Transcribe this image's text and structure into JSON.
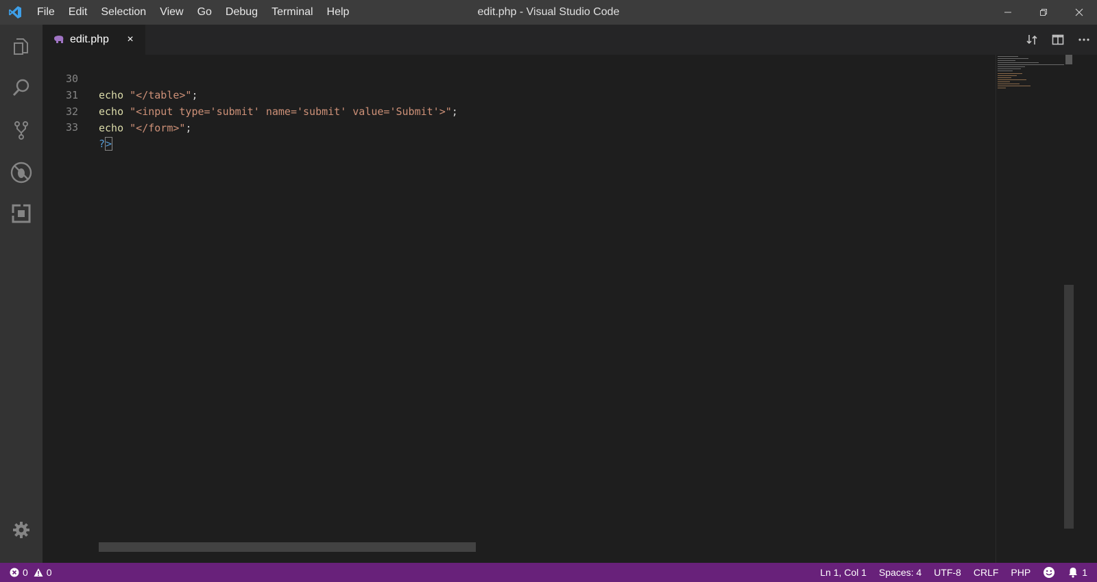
{
  "window": {
    "title": "edit.php - Visual Studio Code"
  },
  "menu": [
    "File",
    "Edit",
    "Selection",
    "View",
    "Go",
    "Debug",
    "Terminal",
    "Help"
  ],
  "activity_bar": {
    "icons": [
      "files-icon",
      "search-icon",
      "source-control-icon",
      "debug-icon",
      "extensions-icon"
    ],
    "bottom_icon": "gear-icon"
  },
  "tab": {
    "label": "edit.php",
    "close": "×"
  },
  "editor": {
    "lines": [
      {
        "num": "30",
        "kw": "echo",
        "str": "\"</table>\"",
        "end": ";"
      },
      {
        "num": "31",
        "kw": "echo",
        "str": "\"<input type='submit' name='submit' value='Submit'>\"",
        "end": ";"
      },
      {
        "num": "32",
        "kw": "echo",
        "str": "\"</form>\"",
        "end": ";"
      },
      {
        "num": "33",
        "tag_open": "?",
        "tag_close": ">"
      }
    ]
  },
  "status_bar": {
    "errors": "0",
    "warnings": "0",
    "position": "Ln 1, Col 1",
    "spaces": "Spaces: 4",
    "encoding": "UTF-8",
    "eol": "CRLF",
    "language": "PHP",
    "notifications": "1"
  },
  "colors": {
    "status_bar": "#68217a",
    "title_bar": "#3c3c3c",
    "activity_bar": "#333333",
    "editor_bg": "#1e1e1e",
    "keyword": "#dcdcaa",
    "string": "#ce9178"
  }
}
